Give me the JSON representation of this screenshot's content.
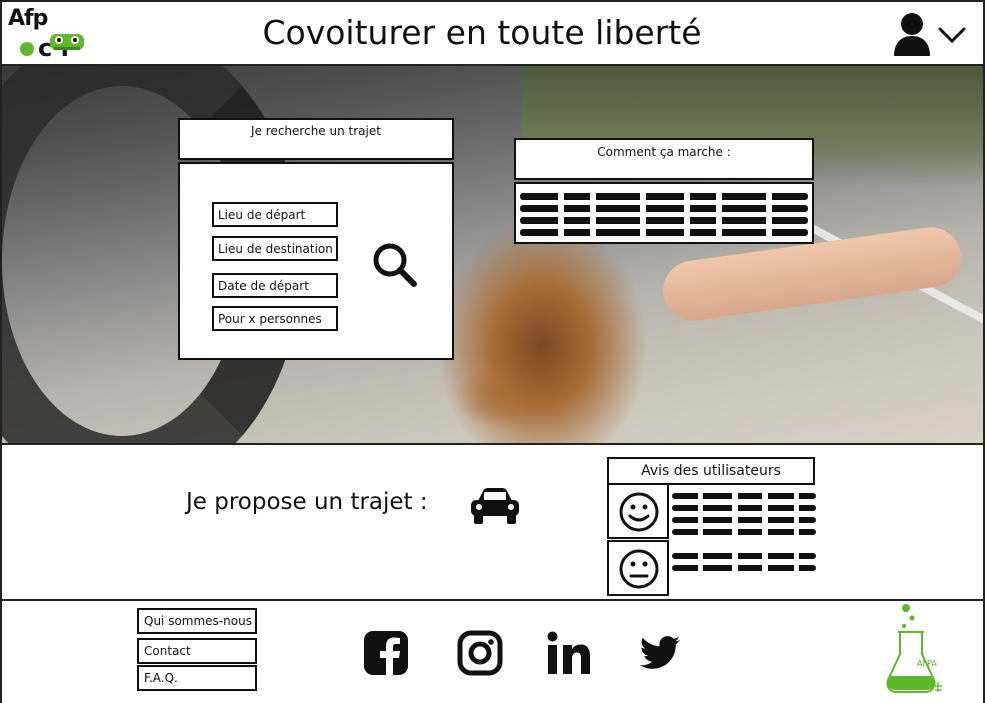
{
  "header": {
    "logo": {
      "line1": "Afp",
      "line2": "c  r",
      "dot_color": "#5db82a"
    },
    "title": "Covoiturer en toute liberté"
  },
  "search": {
    "title": "Je recherche un trajet",
    "fields": [
      {
        "label": "Lieu de départ"
      },
      {
        "label": "Lieu de destination"
      },
      {
        "label": "Date de départ"
      },
      {
        "label": "Pour x personnes"
      }
    ]
  },
  "how_it_works": {
    "title": "Comment ça marche :"
  },
  "propose": {
    "label": "Je propose un trajet :"
  },
  "reviews": {
    "title": "Avis des utilisateurs"
  },
  "footer": {
    "links": [
      {
        "label": "Qui sommes-nous"
      },
      {
        "label": "Contact"
      },
      {
        "label": "F.A.Q."
      }
    ],
    "afpa_label": "AFPA"
  },
  "icons": {
    "user": "user-icon",
    "chevron": "chevron-down-icon",
    "search": "search-icon",
    "car": "car-icon",
    "happy": "smiley-icon",
    "neutral": "neutral-face-icon",
    "facebook": "facebook-icon",
    "instagram": "instagram-icon",
    "linkedin": "linkedin-icon",
    "twitter": "twitter-icon"
  },
  "colors": {
    "brand_green": "#5db82a",
    "border": "#111111"
  }
}
